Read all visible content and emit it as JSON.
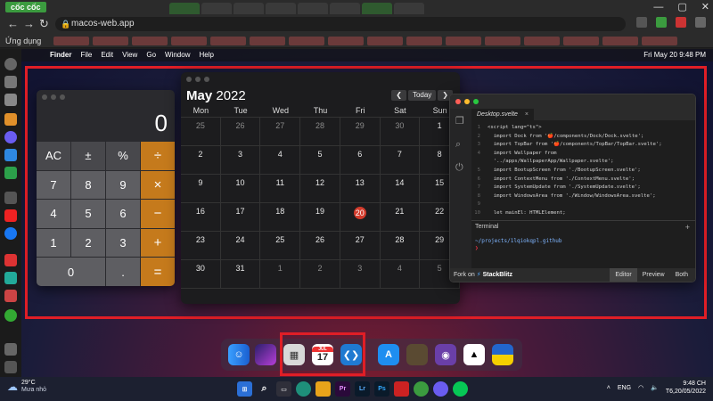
{
  "browser": {
    "logo": "cốc cốc",
    "url": "macos-web.app",
    "bookmarks_label": "Ứng dụng",
    "controls": {
      "minimize": "—",
      "maximize": "▢",
      "close": "✕"
    }
  },
  "menubar": {
    "app_name": "Finder",
    "menus": [
      "File",
      "Edit",
      "View",
      "Go",
      "Window",
      "Help"
    ],
    "clock": "Fri May 20  9:48 PM"
  },
  "calculator": {
    "display": "0",
    "keys": [
      "AC",
      "±",
      "%",
      "÷",
      "7",
      "8",
      "9",
      "×",
      "4",
      "5",
      "6",
      "−",
      "1",
      "2",
      "3",
      "+",
      "0",
      ".",
      "="
    ]
  },
  "calendar": {
    "month": "May",
    "year": "2022",
    "today_label": "Today",
    "prev": "❮",
    "next": "❯",
    "weekdays": [
      "Mon",
      "Tue",
      "Wed",
      "Thu",
      "Fri",
      "Sat",
      "Sun"
    ],
    "days": [
      {
        "d": "25",
        "m": true
      },
      {
        "d": "26",
        "m": true
      },
      {
        "d": "27",
        "m": true
      },
      {
        "d": "28",
        "m": true
      },
      {
        "d": "29",
        "m": true
      },
      {
        "d": "30",
        "m": true
      },
      {
        "d": "1",
        "m": false
      },
      {
        "d": "2",
        "m": false
      },
      {
        "d": "3",
        "m": false
      },
      {
        "d": "4",
        "m": false
      },
      {
        "d": "5",
        "m": false
      },
      {
        "d": "6",
        "m": false
      },
      {
        "d": "7",
        "m": false
      },
      {
        "d": "8",
        "m": false
      },
      {
        "d": "9",
        "m": false
      },
      {
        "d": "10",
        "m": false
      },
      {
        "d": "11",
        "m": false
      },
      {
        "d": "12",
        "m": false
      },
      {
        "d": "13",
        "m": false
      },
      {
        "d": "14",
        "m": false
      },
      {
        "d": "15",
        "m": false
      },
      {
        "d": "16",
        "m": false
      },
      {
        "d": "17",
        "m": false
      },
      {
        "d": "18",
        "m": false
      },
      {
        "d": "19",
        "m": false
      },
      {
        "d": "20",
        "m": false,
        "today": true
      },
      {
        "d": "21",
        "m": false
      },
      {
        "d": "22",
        "m": false
      },
      {
        "d": "23",
        "m": false
      },
      {
        "d": "24",
        "m": false
      },
      {
        "d": "25",
        "m": false
      },
      {
        "d": "26",
        "m": false
      },
      {
        "d": "27",
        "m": false
      },
      {
        "d": "28",
        "m": false
      },
      {
        "d": "29",
        "m": false
      },
      {
        "d": "30",
        "m": false
      },
      {
        "d": "31",
        "m": false
      },
      {
        "d": "1",
        "m": true
      },
      {
        "d": "2",
        "m": true
      },
      {
        "d": "3",
        "m": true
      },
      {
        "d": "4",
        "m": true
      },
      {
        "d": "5",
        "m": true
      }
    ]
  },
  "editor": {
    "tab_name": "Desktop.svelte",
    "tab_close": "×",
    "code_lines": [
      {
        "n": "1",
        "t": "<script lang=\"ts\">"
      },
      {
        "n": "2",
        "t": "  import Dock from '🍎/components/Dock/Dock.svelte';"
      },
      {
        "n": "3",
        "t": "  import TopBar from '🍎/components/TopBar/TopBar.svelte';"
      },
      {
        "n": "4",
        "t": "  import Wallpaper from"
      },
      {
        "n": "",
        "t": "  '../apps/WallpaperApp/Wallpaper.svelte';"
      },
      {
        "n": "5",
        "t": "  import BootupScreen from './BootupScreen.svelte';"
      },
      {
        "n": "6",
        "t": "  import ContextMenu from './ContextMenu.svelte';"
      },
      {
        "n": "7",
        "t": "  import SystemUpdate from './SystemUpdate.svelte';"
      },
      {
        "n": "8",
        "t": "  import WindowsArea from './Window/WindowsArea.svelte';"
      },
      {
        "n": "9",
        "t": ""
      },
      {
        "n": "10",
        "t": "  let mainEl: HTMLElement;"
      }
    ],
    "terminal_title": "Terminal",
    "terminal_plus": "+",
    "terminal_path": "~/projects/1lqiokqpl.github",
    "terminal_prompt": "❯",
    "status_fork": "Fork on",
    "status_brand": "StackBlitz",
    "views": [
      "Editor",
      "Preview",
      "Both"
    ]
  },
  "dock": {
    "calendar_month": "JUL",
    "calendar_day": "17"
  },
  "taskbar": {
    "temp": "29°C",
    "weather": "Mưa nhỏ",
    "lang": "ENG",
    "time": "9:48 CH",
    "date": "T6,20/05/2022",
    "apps": [
      "Pr",
      "Lr",
      "Ps"
    ]
  }
}
